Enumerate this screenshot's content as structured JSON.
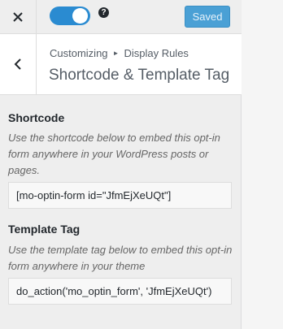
{
  "topbar": {
    "saved_label": "Saved",
    "help_symbol": "?",
    "toggle_on": true
  },
  "header": {
    "breadcrumb_parent": "Customizing",
    "breadcrumb_current": "Display Rules",
    "title": "Shortcode & Template Tag"
  },
  "shortcode": {
    "title": "Shortcode",
    "description": "Use the shortcode below to embed this opt-in form anywhere in your WordPress posts or pages.",
    "value": "[mo-optin-form id=\"JfmEjXeUQt\"]"
  },
  "template_tag": {
    "title": "Template Tag",
    "description": "Use the template tag below to embed this opt-in form anywhere in your theme",
    "value": "do_action('mo_optin_form', 'JfmEjXeUQt')"
  },
  "colors": {
    "accent": "#2a8bd1",
    "saved_button": "#4aa0d5"
  }
}
